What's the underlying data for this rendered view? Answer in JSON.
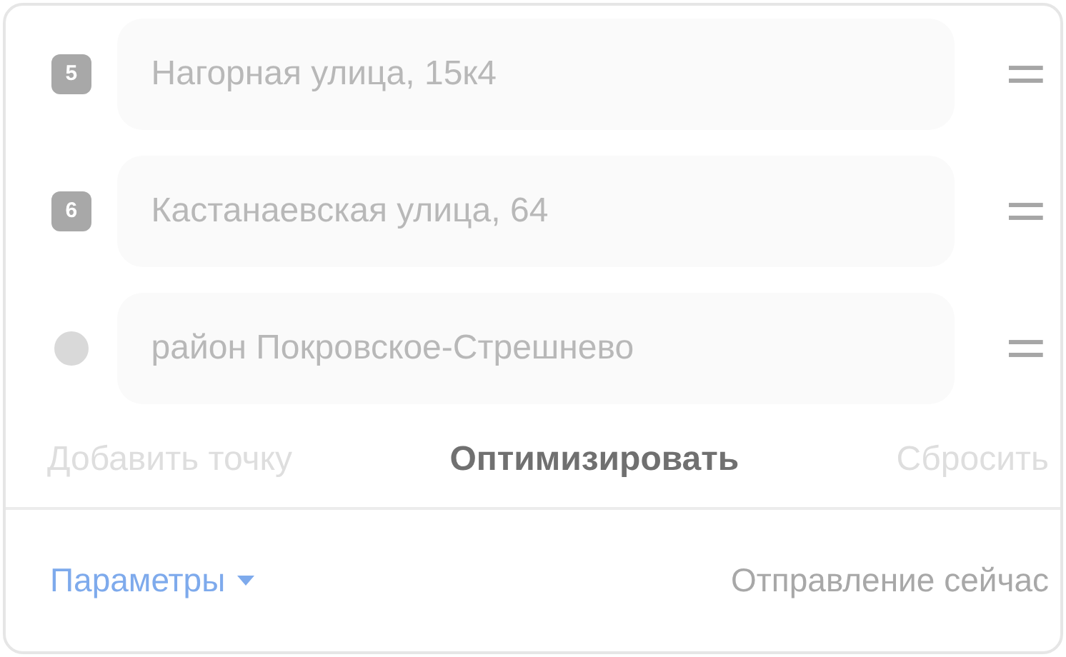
{
  "points": [
    {
      "kind": "number",
      "marker": "5",
      "address": "Нагорная улица, 15к4"
    },
    {
      "kind": "number",
      "marker": "6",
      "address": "Кастанаевская улица, 64"
    },
    {
      "kind": "dot",
      "address": "район Покровское-Стрешнево"
    }
  ],
  "actions": [
    {
      "label": "Добавить точку",
      "disabled": true
    },
    {
      "label": "Оптимизировать",
      "disabled": false
    },
    {
      "label": "Сбросить",
      "disabled": true
    }
  ],
  "footer": {
    "parameters": "Параметры",
    "departure": "Отправление сейчас"
  }
}
